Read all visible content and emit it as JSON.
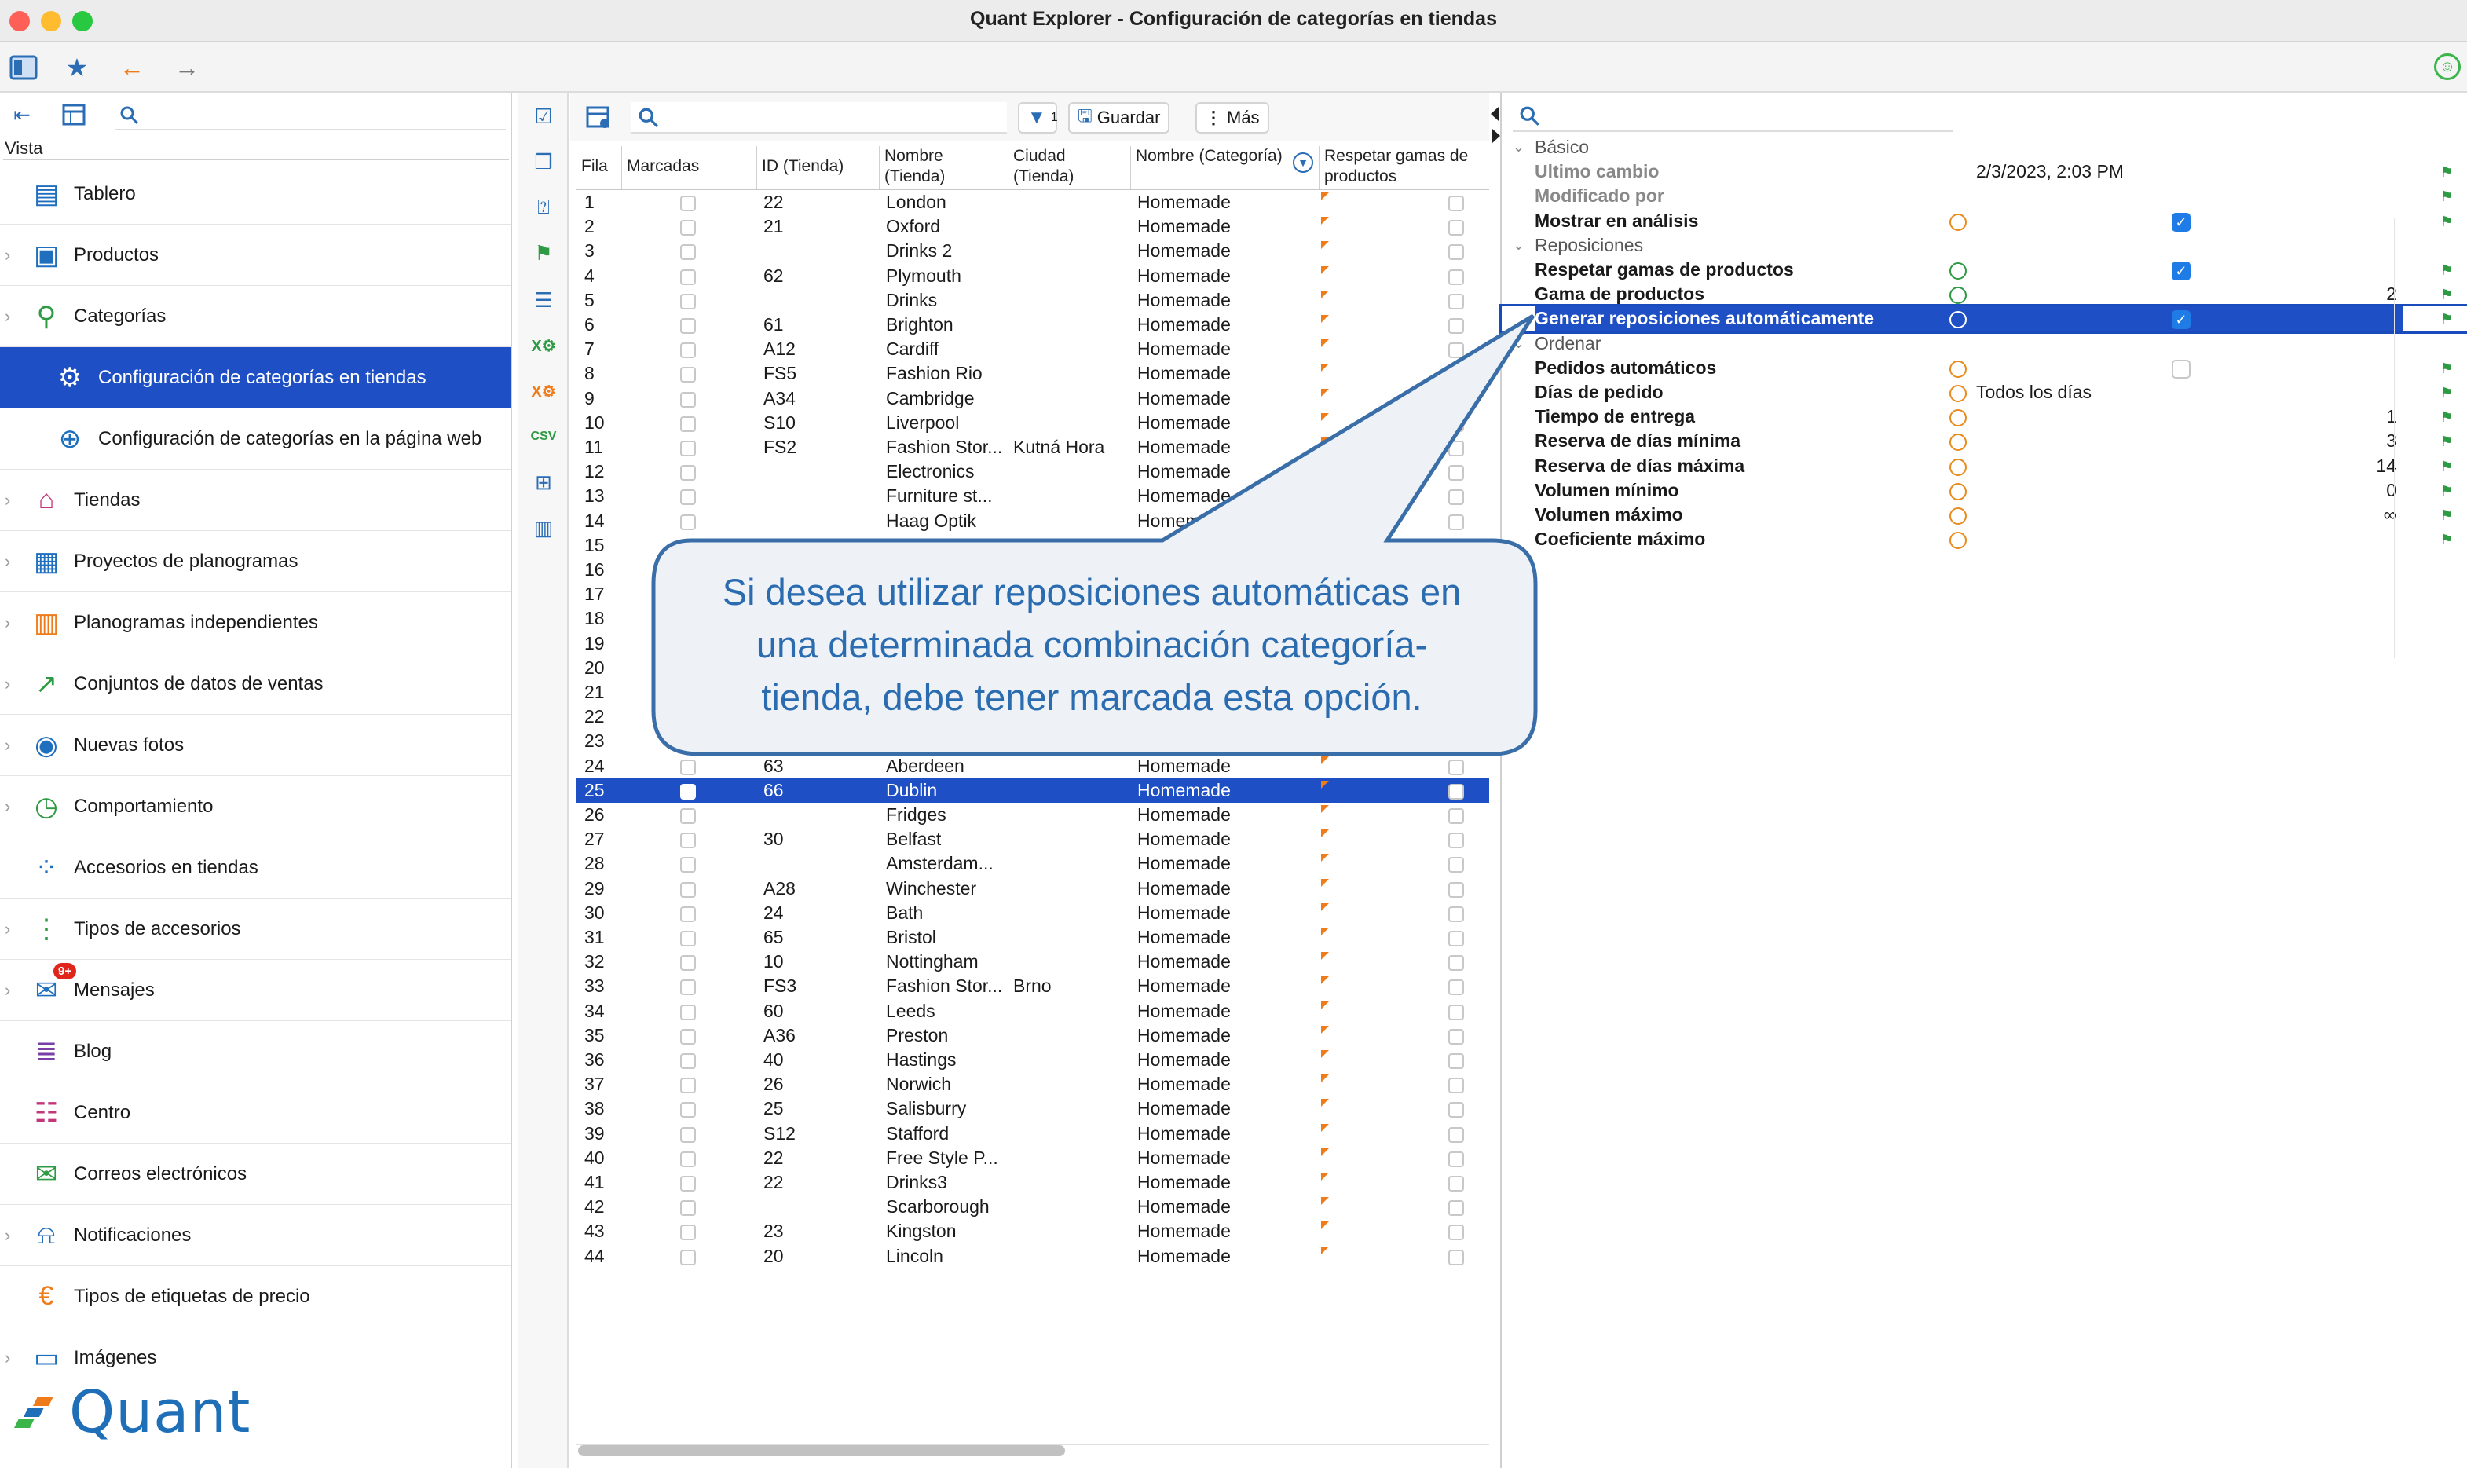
{
  "window": {
    "title": "Quant Explorer - Configuración de categorías en tiendas"
  },
  "sidebar": {
    "vista_label": "Vista",
    "search_placeholder": "",
    "items": [
      {
        "label": "Tablero",
        "icon": "dashboard-icon",
        "color": "#1f6fbf"
      },
      {
        "label": "Productos",
        "icon": "box-icon",
        "color": "#1f6fbf"
      },
      {
        "label": "Categorías",
        "icon": "hierarchy-icon",
        "color": "#2f9a44"
      },
      {
        "label": "Configuración de categorías en tiendas",
        "icon": "gear-store-icon",
        "active": true
      },
      {
        "label": "Configuración de categorías en la página web",
        "icon": "globe-gear-icon"
      },
      {
        "label": "Tiendas",
        "icon": "store-icon",
        "color": "#c2377a"
      },
      {
        "label": "Proyectos de planogramas",
        "icon": "planogram-project-icon"
      },
      {
        "label": "Planogramas independientes",
        "icon": "planogram-icon"
      },
      {
        "label": "Conjuntos de datos de ventas",
        "icon": "sales-data-icon"
      },
      {
        "label": "Nuevas fotos",
        "icon": "camera-icon"
      },
      {
        "label": "Comportamiento",
        "icon": "clock-icon"
      },
      {
        "label": "Accesorios en tiendas",
        "icon": "accessories-icon"
      },
      {
        "label": "Tipos de accesorios",
        "icon": "accessory-types-icon"
      },
      {
        "label": "Mensajes",
        "icon": "chat-icon",
        "badge": "9+"
      },
      {
        "label": "Blog",
        "icon": "blog-icon"
      },
      {
        "label": "Centro",
        "icon": "center-icon"
      },
      {
        "label": "Correos electrónicos",
        "icon": "mail-icon"
      },
      {
        "label": "Notificaciones",
        "icon": "bell-icon"
      },
      {
        "label": "Tipos de etiquetas de precio",
        "icon": "price-tag-icon"
      },
      {
        "label": "Imágenes",
        "icon": "image-icon"
      }
    ],
    "logo_text": "Quant"
  },
  "grid": {
    "save_label": "Guardar",
    "more_label": "Más",
    "filter_count": "1",
    "columns": [
      "Fila",
      "Marcadas",
      "ID (Tienda)",
      "Nombre (Tienda)",
      "Ciudad (Tienda)",
      "Nombre (Categoría)",
      "Respetar gamas de productos"
    ],
    "rows": [
      [
        "1",
        "22",
        "London",
        "",
        "Homemade"
      ],
      [
        "2",
        "21",
        "Oxford",
        "",
        "Homemade"
      ],
      [
        "3",
        "",
        "Drinks 2",
        "",
        "Homemade"
      ],
      [
        "4",
        "62",
        "Plymouth",
        "",
        "Homemade"
      ],
      [
        "5",
        "",
        "Drinks",
        "",
        "Homemade"
      ],
      [
        "6",
        "61",
        "Brighton",
        "",
        "Homemade"
      ],
      [
        "7",
        "A12",
        "Cardiff",
        "",
        "Homemade"
      ],
      [
        "8",
        "FS5",
        "Fashion Rio",
        "",
        "Homemade"
      ],
      [
        "9",
        "A34",
        "Cambridge",
        "",
        "Homemade"
      ],
      [
        "10",
        "S10",
        "Liverpool",
        "",
        "Homemade"
      ],
      [
        "11",
        "FS2",
        "Fashion Stor...",
        "Kutná Hora",
        "Homemade"
      ],
      [
        "12",
        "",
        "Electronics",
        "",
        "Homemade"
      ],
      [
        "13",
        "",
        "Furniture st...",
        "",
        "Homemade"
      ],
      [
        "14",
        "",
        "Haag Optik",
        "",
        "Homemade"
      ],
      [
        "15",
        "",
        "",
        "",
        ""
      ],
      [
        "16",
        "",
        "",
        "",
        ""
      ],
      [
        "17",
        "",
        "",
        "",
        ""
      ],
      [
        "18",
        "",
        "",
        "",
        ""
      ],
      [
        "19",
        "",
        "",
        "",
        ""
      ],
      [
        "20",
        "",
        "",
        "",
        ""
      ],
      [
        "21",
        "",
        "",
        "",
        ""
      ],
      [
        "22",
        "",
        "",
        "",
        ""
      ],
      [
        "23",
        "",
        "",
        "",
        ""
      ],
      [
        "24",
        "63",
        "Aberdeen",
        "",
        "Homemade"
      ],
      [
        "25",
        "66",
        "Dublin",
        "",
        "Homemade"
      ],
      [
        "26",
        "",
        "Fridges",
        "",
        "Homemade"
      ],
      [
        "27",
        "30",
        "Belfast",
        "",
        "Homemade"
      ],
      [
        "28",
        "",
        "Amsterdam...",
        "",
        "Homemade"
      ],
      [
        "29",
        "A28",
        "Winchester",
        "",
        "Homemade"
      ],
      [
        "30",
        "24",
        "Bath",
        "",
        "Homemade"
      ],
      [
        "31",
        "65",
        "Bristol",
        "",
        "Homemade"
      ],
      [
        "32",
        "10",
        "Nottingham",
        "",
        "Homemade"
      ],
      [
        "33",
        "FS3",
        "Fashion Stor...",
        "Brno",
        "Homemade"
      ],
      [
        "34",
        "60",
        "Leeds",
        "",
        "Homemade"
      ],
      [
        "35",
        "A36",
        "Preston",
        "",
        "Homemade"
      ],
      [
        "36",
        "40",
        "Hastings",
        "",
        "Homemade"
      ],
      [
        "37",
        "26",
        "Norwich",
        "",
        "Homemade"
      ],
      [
        "38",
        "25",
        "Salisburry",
        "",
        "Homemade"
      ],
      [
        "39",
        "S12",
        "Stafford",
        "",
        "Homemade"
      ],
      [
        "40",
        "22",
        "Free Style P...",
        "",
        "Homemade"
      ],
      [
        "41",
        "22",
        "Drinks3",
        "",
        "Homemade"
      ],
      [
        "42",
        "",
        "Scarborough",
        "",
        "Homemade"
      ],
      [
        "43",
        "23",
        "Kingston",
        "",
        "Homemade"
      ],
      [
        "44",
        "20",
        "Lincoln",
        "",
        "Homemade"
      ]
    ],
    "selected_row": "25"
  },
  "properties": {
    "rows": [
      {
        "type": "group",
        "label": "Básico"
      },
      {
        "type": "gray",
        "label": "Ultimo cambio",
        "value": "2/3/2023, 2:03 PM"
      },
      {
        "type": "gray",
        "label": "Modificado por",
        "value": ""
      },
      {
        "type": "bold",
        "label": "Mostrar en análisis",
        "icon": "orange",
        "check": true
      },
      {
        "type": "group",
        "label": "Reposiciones"
      },
      {
        "type": "bold",
        "label": "Respetar gamas de productos",
        "icon": "green",
        "check": true
      },
      {
        "type": "bold",
        "label": "Gama de productos",
        "icon": "green",
        "num": "2"
      },
      {
        "type": "selected",
        "label": "Generar reposiciones automáticamente",
        "icon": "green",
        "check": true
      },
      {
        "type": "group",
        "label": "Ordenar"
      },
      {
        "type": "bold",
        "label": "Pedidos automáticos",
        "icon": "orange",
        "check": false
      },
      {
        "type": "bold",
        "label": "Días de pedido",
        "icon": "orange",
        "value": "Todos los días"
      },
      {
        "type": "bold",
        "label": "Tiempo de entrega",
        "icon": "orange",
        "num": "1"
      },
      {
        "type": "bold",
        "label": "Reserva de días mínima",
        "icon": "orange",
        "num": "3"
      },
      {
        "type": "bold",
        "label": "Reserva de días máxima",
        "icon": "orange",
        "num": "14"
      },
      {
        "type": "bold",
        "label": "Volumen mínimo",
        "icon": "orange",
        "num": "0"
      },
      {
        "type": "bold",
        "label": "Volumen máximo",
        "icon": "orange",
        "num": "∞"
      },
      {
        "type": "bold",
        "label": "Coeficiente máximo",
        "icon": "orange",
        "num": ""
      }
    ]
  },
  "callout": {
    "lines": [
      "Si desea utilizar reposiciones automáticas en",
      "una determinada combinación categoría-",
      "tienda, debe tener marcada esta opción."
    ]
  },
  "colors": {
    "selection": "#1f4fc4",
    "accent": "#2b6cb0",
    "check": "#1f7be6",
    "flag": "#ef7c1a"
  }
}
